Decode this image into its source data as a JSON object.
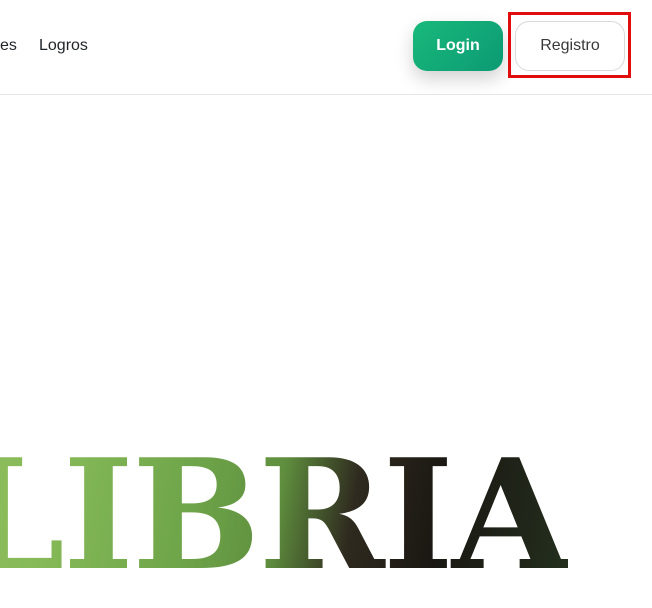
{
  "nav": {
    "partial_link": "es",
    "logros": "Logros"
  },
  "buttons": {
    "login": "Login",
    "registro": "Registro"
  },
  "hero": {
    "title_visible": "LIBRIA"
  },
  "colors": {
    "login_gradient_start": "#18b97b",
    "login_gradient_end": "#0c9a73",
    "highlight": "#e10d0d"
  }
}
